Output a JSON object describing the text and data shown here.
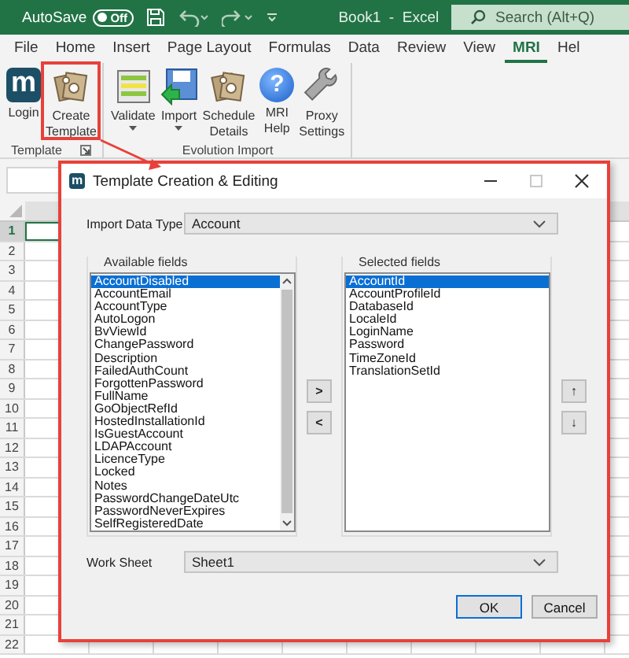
{
  "title_bar": {
    "autosave_label": "AutoSave",
    "autosave_toggle": {
      "label": "Off",
      "on": false
    },
    "title": "Book1  -  Excel",
    "search": {
      "placeholder": "Search (Alt+Q)"
    }
  },
  "ribbon_tabs": [
    {
      "label": "File",
      "selected": false
    },
    {
      "label": "Home",
      "selected": false
    },
    {
      "label": "Insert",
      "selected": false
    },
    {
      "label": "Page Layout",
      "selected": false
    },
    {
      "label": "Formulas",
      "selected": false
    },
    {
      "label": "Data",
      "selected": false
    },
    {
      "label": "Review",
      "selected": false
    },
    {
      "label": "View",
      "selected": false
    },
    {
      "label": "MRI",
      "selected": true
    },
    {
      "label": "Hel",
      "selected": false
    }
  ],
  "ribbon_groups": [
    {
      "label": "Template",
      "launcher": true,
      "buttons": [
        {
          "label": "Login",
          "kind": "logo",
          "glyph": "m",
          "dropdown": false
        },
        {
          "label": "Create Template",
          "kind": "template",
          "dropdown": false
        }
      ]
    },
    {
      "label": "Evolution Import",
      "launcher": false,
      "buttons": [
        {
          "label": "Validate",
          "kind": "validate",
          "dropdown": true
        },
        {
          "label": "Import",
          "kind": "import",
          "dropdown": true
        },
        {
          "label": "Schedule Details",
          "kind": "template",
          "dropdown": false
        },
        {
          "label": "MRI Help",
          "kind": "help",
          "glyph": "?",
          "dropdown": false
        },
        {
          "label": "Proxy Settings",
          "kind": "wrench",
          "dropdown": false
        }
      ]
    }
  ],
  "sheet": {
    "rows": [
      {
        "label": "1",
        "selected": true
      },
      {
        "label": "2",
        "selected": false
      },
      {
        "label": "3",
        "selected": false
      },
      {
        "label": "4",
        "selected": false
      },
      {
        "label": "5",
        "selected": false
      },
      {
        "label": "6",
        "selected": false
      },
      {
        "label": "7",
        "selected": false
      },
      {
        "label": "8",
        "selected": false
      },
      {
        "label": "9",
        "selected": false
      },
      {
        "label": "10",
        "selected": false
      },
      {
        "label": "11",
        "selected": false
      },
      {
        "label": "12",
        "selected": false
      },
      {
        "label": "13",
        "selected": false
      },
      {
        "label": "14",
        "selected": false
      },
      {
        "label": "15",
        "selected": false
      },
      {
        "label": "16",
        "selected": false
      },
      {
        "label": "17",
        "selected": false
      },
      {
        "label": "18",
        "selected": false
      },
      {
        "label": "19",
        "selected": false
      },
      {
        "label": "20",
        "selected": false
      },
      {
        "label": "21",
        "selected": false
      },
      {
        "label": "22",
        "selected": false
      }
    ]
  },
  "dialog": {
    "icon_glyph": "m",
    "title": "Template Creation & Editing",
    "import_data_type": {
      "label": "Import Data Type",
      "value": "Account"
    },
    "available_fields": {
      "label": "Available fields",
      "items": [
        {
          "text": "AccountDisabled",
          "selected": true
        },
        {
          "text": "AccountEmail",
          "selected": false
        },
        {
          "text": "AccountType",
          "selected": false
        },
        {
          "text": "AutoLogon",
          "selected": false
        },
        {
          "text": "BvViewId",
          "selected": false
        },
        {
          "text": "ChangePassword",
          "selected": false
        },
        {
          "text": "Description",
          "selected": false
        },
        {
          "text": "FailedAuthCount",
          "selected": false
        },
        {
          "text": "ForgottenPassword",
          "selected": false
        },
        {
          "text": "FullName",
          "selected": false
        },
        {
          "text": "GoObjectRefId",
          "selected": false
        },
        {
          "text": "HostedInstallationId",
          "selected": false
        },
        {
          "text": "IsGuestAccount",
          "selected": false
        },
        {
          "text": "LDAPAccount",
          "selected": false
        },
        {
          "text": "LicenceType",
          "selected": false
        },
        {
          "text": "Locked",
          "selected": false
        },
        {
          "text": "Notes",
          "selected": false
        },
        {
          "text": "PasswordChangeDateUtc",
          "selected": false
        },
        {
          "text": "PasswordNeverExpires",
          "selected": false
        },
        {
          "text": "SelfRegisteredDate",
          "selected": false
        }
      ]
    },
    "move_buttons": [
      ">",
      "<"
    ],
    "selected_fields": {
      "label": "Selected fields",
      "items": [
        {
          "text": "AccountId",
          "selected": true
        },
        {
          "text": "AccountProfileId",
          "selected": false
        },
        {
          "text": "DatabaseId",
          "selected": false
        },
        {
          "text": "LocaleId",
          "selected": false
        },
        {
          "text": "LoginName",
          "selected": false
        },
        {
          "text": "Password",
          "selected": false
        },
        {
          "text": "TimeZoneId",
          "selected": false
        },
        {
          "text": "TranslationSetId",
          "selected": false
        }
      ]
    },
    "order_buttons": [
      "↑",
      "↓"
    ],
    "work_sheet": {
      "label": "Work Sheet",
      "value": "Sheet1"
    },
    "buttons": [
      {
        "label": "OK",
        "default": true
      },
      {
        "label": "Cancel",
        "default": false
      }
    ]
  }
}
